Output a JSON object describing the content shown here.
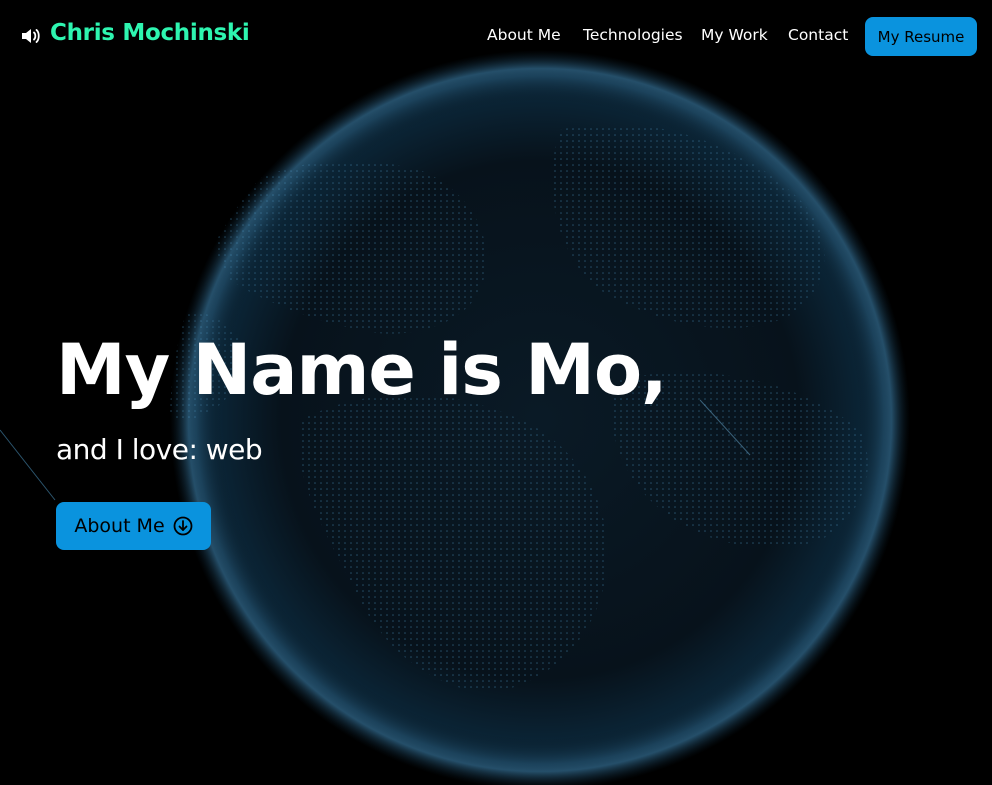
{
  "header": {
    "brand": "Chris Mochinski",
    "sound_icon": "speaker-icon",
    "nav": [
      {
        "label": "About Me"
      },
      {
        "label": "Technologies"
      },
      {
        "label": "My Work"
      },
      {
        "label": "Contact"
      }
    ],
    "resume_button": "My Resume"
  },
  "hero": {
    "title": "My Name is Mo,",
    "subtitle": "and I love: web",
    "about_button": "About Me",
    "about_button_icon": "arrow-down-circle-icon"
  },
  "colors": {
    "brand": "#2ef5b0",
    "accent": "#0a93de",
    "background": "#000000"
  }
}
